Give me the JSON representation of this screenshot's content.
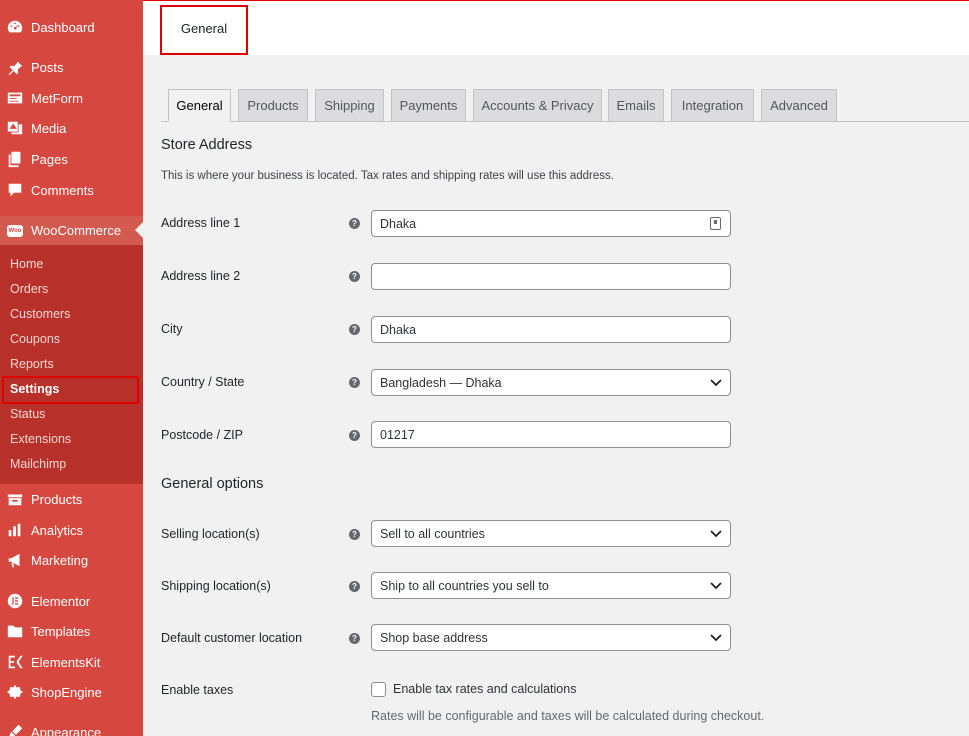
{
  "sidebar": {
    "items": [
      {
        "label": "Dashboard",
        "icon": "dashboard-icon"
      },
      {
        "label": "Posts",
        "icon": "pin-icon"
      },
      {
        "label": "MetForm",
        "icon": "form-icon"
      },
      {
        "label": "Media",
        "icon": "media-icon"
      },
      {
        "label": "Pages",
        "icon": "pages-icon"
      },
      {
        "label": "Comments",
        "icon": "comment-icon"
      },
      {
        "label": "WooCommerce",
        "icon": "woo-icon"
      },
      {
        "label": "Products",
        "icon": "products-icon"
      },
      {
        "label": "Analytics",
        "icon": "analytics-icon"
      },
      {
        "label": "Marketing",
        "icon": "megaphone-icon"
      },
      {
        "label": "Elementor",
        "icon": "elementor-icon"
      },
      {
        "label": "Templates",
        "icon": "folder-icon"
      },
      {
        "label": "ElementsKit",
        "icon": "elementskit-icon"
      },
      {
        "label": "ShopEngine",
        "icon": "shopengine-icon"
      },
      {
        "label": "Appearance",
        "icon": "brush-icon"
      }
    ],
    "submenu": [
      "Home",
      "Orders",
      "Customers",
      "Coupons",
      "Reports",
      "Settings",
      "Status",
      "Extensions",
      "Mailchimp"
    ],
    "woo_badge": "Woo"
  },
  "header": {
    "top_tab": "General"
  },
  "tabs": [
    "General",
    "Products",
    "Shipping",
    "Payments",
    "Accounts & Privacy",
    "Emails",
    "Integration",
    "Advanced"
  ],
  "store_address": {
    "title": "Store Address",
    "description": "This is where your business is located. Tax rates and shipping rates will use this address.",
    "fields": [
      {
        "label": "Address line 1",
        "value": "Dhaka"
      },
      {
        "label": "Address line 2",
        "value": ""
      },
      {
        "label": "City",
        "value": "Dhaka"
      },
      {
        "label": "Country / State",
        "value": "Bangladesh — Dhaka"
      },
      {
        "label": "Postcode / ZIP",
        "value": "01217"
      }
    ]
  },
  "general_options": {
    "title": "General options",
    "fields": [
      {
        "label": "Selling location(s)",
        "value": "Sell to all countries"
      },
      {
        "label": "Shipping location(s)",
        "value": "Ship to all countries you sell to"
      },
      {
        "label": "Default customer location",
        "value": "Shop base address"
      }
    ],
    "taxes": {
      "label": "Enable taxes",
      "checkbox_label": "Enable tax rates and calculations",
      "checked": false,
      "description": "Rates will be configurable and taxes will be calculated during checkout."
    }
  },
  "help_glyph": "?",
  "colors": {
    "sidebar": "#d5473f",
    "submenu": "#b8302a",
    "highlight": "#e00000"
  }
}
